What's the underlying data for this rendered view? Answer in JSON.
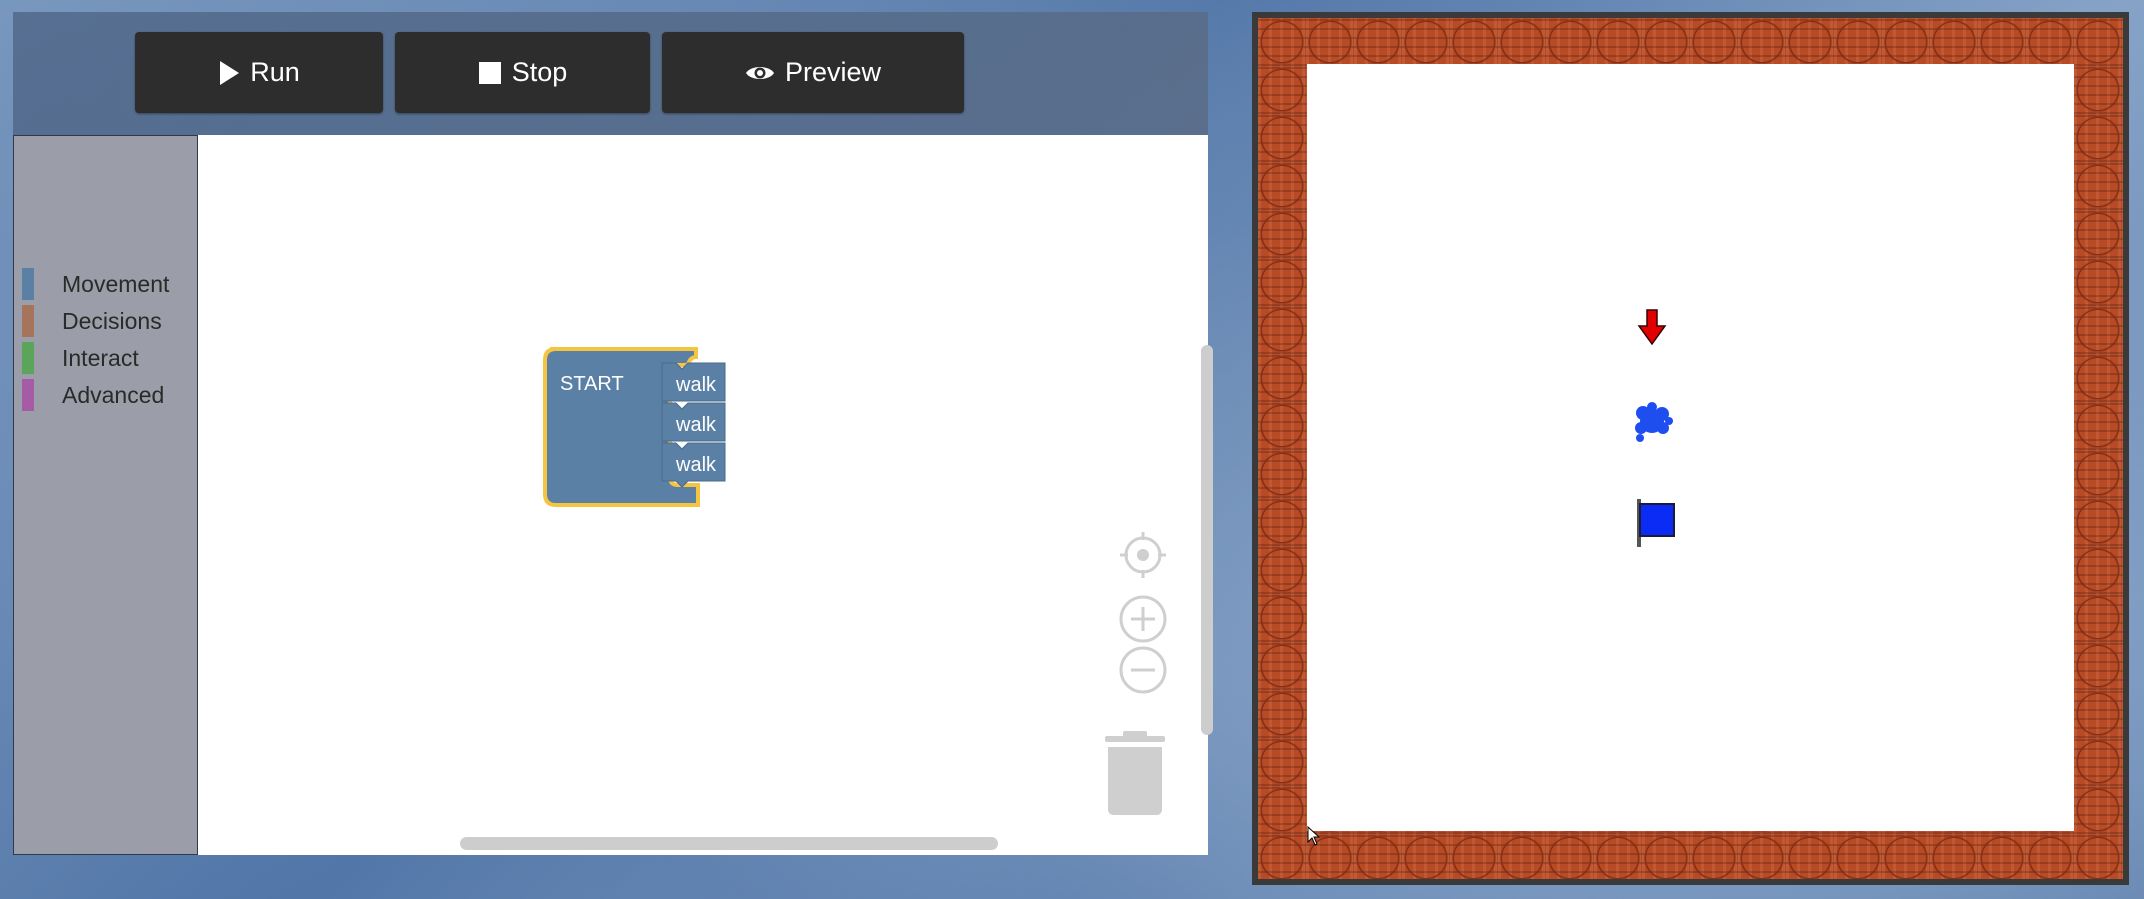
{
  "toolbar": {
    "run_label": "Run",
    "stop_label": "Stop",
    "preview_label": "Preview"
  },
  "toolbox": {
    "categories": [
      {
        "label": "Movement",
        "color": "#5b80a5"
      },
      {
        "label": "Decisions",
        "color": "#a5745b"
      },
      {
        "label": "Interact",
        "color": "#5ba55b"
      },
      {
        "label": "Advanced",
        "color": "#a55ba5"
      }
    ]
  },
  "program": {
    "start_label": "START",
    "steps": [
      "walk",
      "walk",
      "walk"
    ],
    "block_color": "#5b80a5",
    "highlight_color": "#f5c542"
  },
  "workspace_controls": [
    "recenter-icon",
    "zoom-in-icon",
    "zoom-out-icon",
    "trash-icon"
  ],
  "game": {
    "player": "red-arrow-down-icon",
    "puddle": "blue-splat-icon",
    "goal": "blue-flag-icon",
    "wall_color": "#b84a26",
    "frame_color": "#3a3a3a"
  }
}
